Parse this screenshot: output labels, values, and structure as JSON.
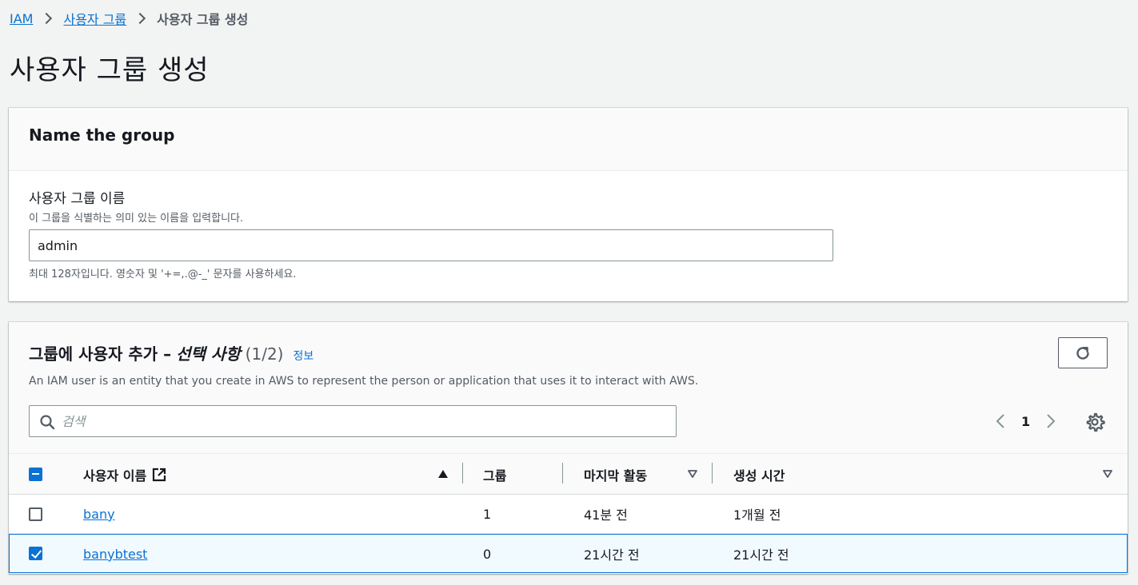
{
  "breadcrumb": {
    "items": [
      "IAM",
      "사용자 그룹"
    ],
    "current": "사용자 그룹 생성"
  },
  "page_title": "사용자 그룹 생성",
  "name_section": {
    "header": "Name the group",
    "field_label": "사용자 그룹 이름",
    "field_description": "이 그룹을 식별하는 의미 있는 이름을 입력합니다.",
    "field_value": "admin",
    "field_constraint": "최대 128자입니다. 영숫자 및 '+=,.@-_' 문자를 사용하세요."
  },
  "users_section": {
    "title_main": "그룹에 사용자 추가 –",
    "title_optional": "선택 사항",
    "count": "(1/2)",
    "info_link": "정보",
    "description": "An IAM user is an entity that you create in AWS to represent the person or application that uses it to interact with AWS.",
    "search_placeholder": "검색",
    "current_page": "1",
    "columns": [
      "사용자 이름",
      "그룹",
      "마지막 활동",
      "생성 시간"
    ],
    "rows": [
      {
        "name": "bany",
        "groups": "1",
        "last_activity": "41분 전",
        "created": "1개월 전",
        "selected": false
      },
      {
        "name": "banybtest",
        "groups": "0",
        "last_activity": "21시간 전",
        "created": "21시간 전",
        "selected": true
      }
    ]
  },
  "colors": {
    "link": "#0972d3",
    "selected_row_bg": "#f1faff",
    "page_bg": "#f2f3f3"
  },
  "icons": [
    "chevron-right-icon",
    "refresh-icon",
    "search-icon",
    "chevron-left-icon",
    "settings-gear-icon",
    "external-link-icon",
    "sort-ascending-icon",
    "sort-descending-icon"
  ]
}
